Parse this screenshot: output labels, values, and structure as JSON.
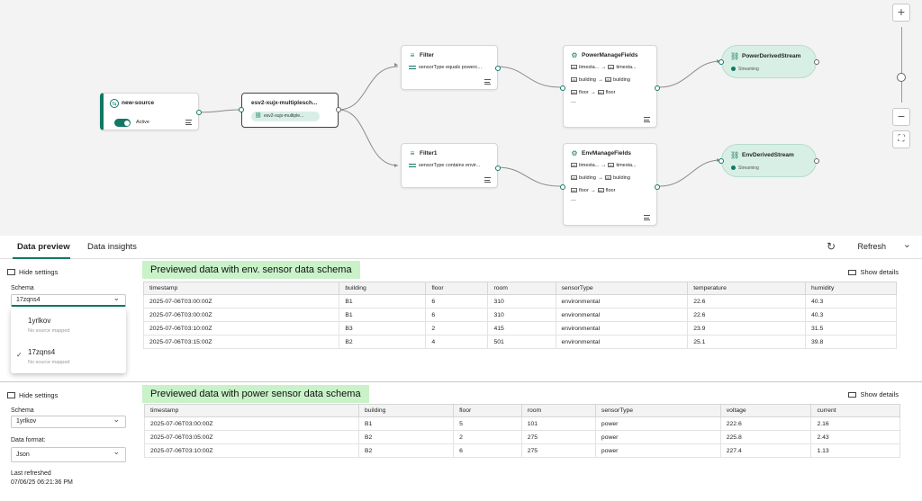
{
  "canvas": {
    "source": {
      "title": "new-source",
      "status": "Active"
    },
    "eventstream": {
      "title": "esv2-xujx-multiplesch...",
      "chip": "esv2-xujx-multiple..."
    },
    "filters": [
      {
        "title": "Filter",
        "condition": "sensorType equals powerc..."
      },
      {
        "title": "Filter1",
        "condition": "sensorType contains envir..."
      }
    ],
    "manage_fields": [
      {
        "title": "PowerManageFields",
        "rows": [
          [
            "timesta...",
            "timesta..."
          ],
          [
            "building",
            "building"
          ],
          [
            "floor",
            "floor"
          ]
        ],
        "more": "..."
      },
      {
        "title": "EnvManageFields",
        "rows": [
          [
            "timesta...",
            "timesta..."
          ],
          [
            "building",
            "building"
          ],
          [
            "floor",
            "floor"
          ]
        ],
        "more": "..."
      }
    ],
    "streams": [
      {
        "title": "PowerDerivedStream",
        "status": "Streaming"
      },
      {
        "title": "EnvDerivedStream",
        "status": "Streaming"
      }
    ],
    "zoom": {
      "plus": "+",
      "minus": "−",
      "fit": "⛶",
      "level": 0.65
    }
  },
  "tabs": {
    "preview": "Data preview",
    "insights": "Data insights",
    "refresh": "Refresh"
  },
  "panel1": {
    "hide_settings": "Hide settings",
    "schema_label": "Schema",
    "schema_value": "17zqns4",
    "callout": "Previewed data with env. sensor data schema",
    "show_details": "Show details",
    "dropdown": {
      "options": [
        {
          "name": "1yrlkov",
          "sub": "No source mapped",
          "selected": false
        },
        {
          "name": "17zqns4",
          "sub": "No source mapped",
          "selected": true
        }
      ]
    },
    "columns": [
      "timestamp",
      "building",
      "floor",
      "room",
      "sensorType",
      "temperature",
      "humidity"
    ],
    "rows": [
      [
        "2025-07-06T03:00:00Z",
        "B1",
        "6",
        "310",
        "environmental",
        "22.6",
        "40.3"
      ],
      [
        "2025-07-06T03:00:00Z",
        "B1",
        "6",
        "310",
        "environmental",
        "22.6",
        "40.3"
      ],
      [
        "2025-07-06T03:10:00Z",
        "B3",
        "2",
        "415",
        "environmental",
        "23.9",
        "31.5"
      ],
      [
        "2025-07-06T03:15:00Z",
        "B2",
        "4",
        "501",
        "environmental",
        "25.1",
        "39.8"
      ]
    ]
  },
  "panel2": {
    "hide_settings": "Hide settings",
    "schema_label": "Schema",
    "schema_value": "1yrlkov",
    "format_label": "Data format:",
    "format_value": "Json",
    "last_refreshed_label": "Last refreshed",
    "last_refreshed_value": "07/06/25 06:21:36 PM",
    "callout": "Previewed data with power sensor data schema",
    "show_details": "Show details",
    "columns": [
      "timestamp",
      "building",
      "floor",
      "room",
      "sensorType",
      "voltage",
      "current"
    ],
    "rows": [
      [
        "2025-07-06T03:00:00Z",
        "B1",
        "5",
        "101",
        "power",
        "222.6",
        "2.16"
      ],
      [
        "2025-07-06T03:05:00Z",
        "B2",
        "2",
        "275",
        "power",
        "225.8",
        "2.43"
      ],
      [
        "2025-07-06T03:10:00Z",
        "B2",
        "6",
        "275",
        "power",
        "227.4",
        "1.13"
      ]
    ]
  },
  "colors": {
    "accent": "#117865",
    "callout": "#c9f2c9",
    "stream_fill": "#d8efe6"
  }
}
